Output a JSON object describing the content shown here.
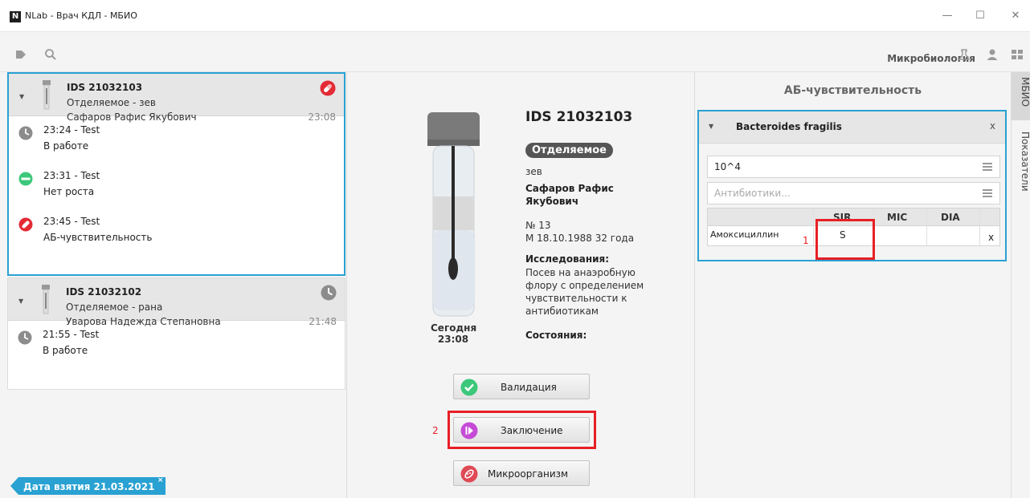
{
  "window": {
    "logo_letter": "N",
    "title": "NLab - Врач КДЛ - МБИО",
    "minimize": "—",
    "maximize": "☐",
    "close": "✕"
  },
  "toolbar": {
    "section": "Микробиология"
  },
  "samples": [
    {
      "id": "IDS 21032103",
      "type": "Отделяемое  -  зев",
      "patient": "Сафаров Рафис Якубович",
      "time": "23:08",
      "events": [
        {
          "time": "23:24  -  Test",
          "status": "В работе",
          "icon": "clock-icon"
        },
        {
          "time": "23:31  -  Test",
          "status": "Нет роста",
          "icon": "no-growth-icon"
        },
        {
          "time": "23:45  -  Test",
          "status": "АБ-чувствительность",
          "icon": "antibiotic-icon"
        }
      ]
    },
    {
      "id": "IDS 21032102",
      "type": "Отделяемое  -  рана",
      "patient": "Уварова Надежда Степановна",
      "time": "21:48",
      "events": [
        {
          "time": "21:55  -  Test",
          "status": "В работе",
          "icon": "clock-icon"
        }
      ]
    }
  ],
  "filter_tag": {
    "label": "Дата взятия 21.03.2021",
    "close": "×"
  },
  "detail": {
    "id": "IDS 21032103",
    "type_badge": "Отделяемое",
    "site": "зев",
    "patient": "Сафаров Рафис Якубович",
    "number": "№ 13",
    "birth": "М  18.10.1988  32 года",
    "research_header": "Исследования:",
    "research": "Посев на анаэробную флору с определением чувствительности к антибиотикам",
    "states_header": "Состояния:",
    "today_label": "Сегодня",
    "today_time": "23:08"
  },
  "actions": {
    "validation": "Валидация",
    "conclusion": "Заключение",
    "microorganism": "Микроорганизм",
    "marker_2": "2"
  },
  "susceptibility": {
    "title": "АБ-чувствительность",
    "organism": "Bacteroides fragilis",
    "close": "x",
    "count_value": "10^4",
    "antibiotics_placeholder": "Антибиотики...",
    "columns": [
      "SIR",
      "MIC",
      "DIA"
    ],
    "rows": [
      {
        "antibiotic": "Амоксициллин",
        "sir": "S",
        "mic": "",
        "dia": "",
        "remove": "x"
      }
    ],
    "marker_1": "1"
  },
  "side_tabs": [
    "МБИО",
    "Показатели"
  ],
  "colors": {
    "accent": "#29a1d2",
    "highlight": "#e81f25"
  }
}
